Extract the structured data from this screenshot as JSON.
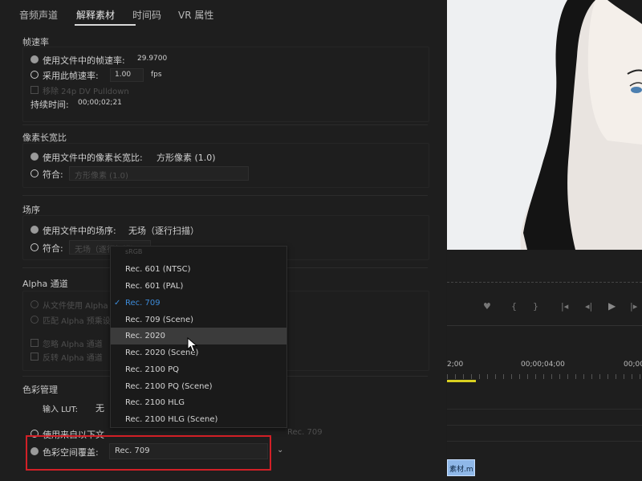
{
  "tabs": [
    "音频声道",
    "解释素材",
    "时间码",
    "VR 属性"
  ],
  "frame_rate": {
    "title": "帧速率",
    "use_file_label": "使用文件中的帧速率:",
    "use_file_value": "29.9700",
    "assume_label": "采用此帧速率:",
    "assume_value": "1.00",
    "assume_unit": "fps",
    "pulldown_label": "移除 24p DV Pulldown",
    "duration_label": "持续时间:",
    "duration_value": "00;00;02;21"
  },
  "pixel_aspect": {
    "title": "像素长宽比",
    "use_file_label": "使用文件中的像素长宽比:",
    "use_file_value": "方形像素 (1.0)",
    "conform_label": "符合:",
    "conform_value": "方形像素 (1.0)"
  },
  "field_order": {
    "title": "场序",
    "use_file_label": "使用文件中的场序:",
    "use_file_value": "无场（逐行扫描）",
    "conform_label": "符合:",
    "conform_value": "无场（逐行扫描）"
  },
  "alpha": {
    "title": "Alpha 通道",
    "opt1": "从文件使用 Alpha",
    "opt2": "匹配 Alpha 预乘设置",
    "chk1": "忽略 Alpha 通道",
    "chk2": "反转 Alpha 通道"
  },
  "color": {
    "title": "色彩管理",
    "lut_label": "输入 LUT:",
    "lut_value": "无",
    "use_context_label": "使用来自以下文",
    "use_context_value": "Rec. 709",
    "override_label": "色彩空间覆盖:",
    "override_value": "Rec. 709"
  },
  "dropdown": {
    "header": "sRGB",
    "options": [
      "Rec. 601 (NTSC)",
      "Rec. 601 (PAL)",
      "Rec. 709",
      "Rec. 709 (Scene)",
      "Rec. 2020",
      "Rec. 2020 (Scene)",
      "Rec. 2100 PQ",
      "Rec. 2100 PQ (Scene)",
      "Rec. 2100 HLG",
      "Rec. 2100 HLG (Scene)"
    ],
    "selected": "Rec. 709",
    "hovered": "Rec. 2020"
  },
  "timeline": {
    "time_left": "2;00",
    "time_mid": "00;00;04;00",
    "time_right": "00;00",
    "clip_label": "素材.m"
  },
  "colors": {
    "accent": "#3d8bd9",
    "highlight": "#d22027",
    "timeline_marker": "#d9d020",
    "clip": "#8fb8e8"
  }
}
